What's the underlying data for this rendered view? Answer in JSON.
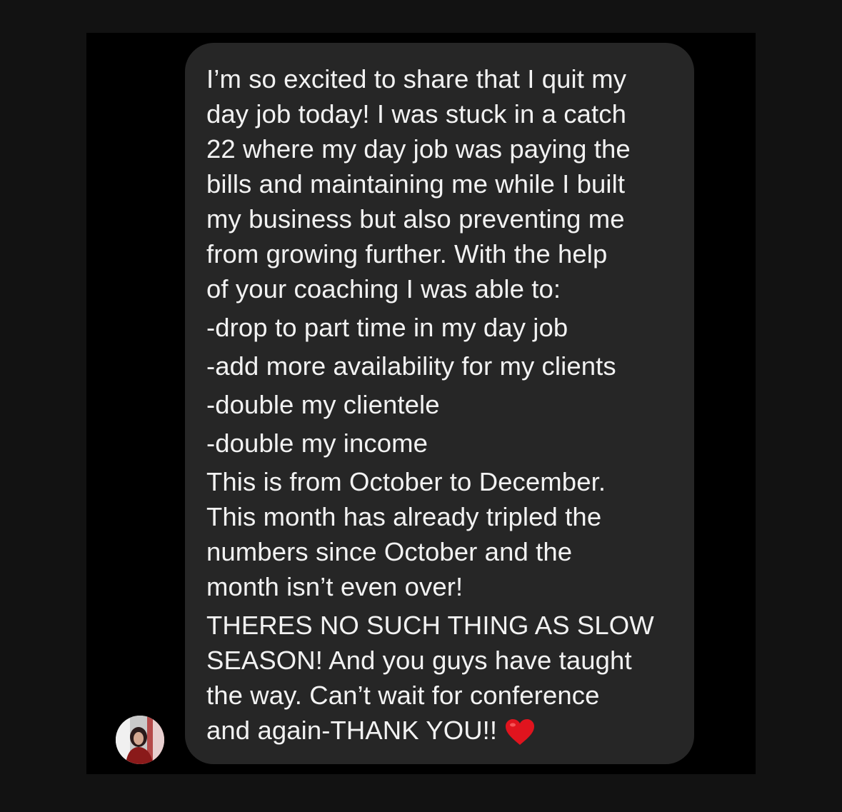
{
  "message": {
    "lines": [
      "I’m so excited to share that I quit my",
      "day job today! I was stuck in a catch",
      "22 where my day job was paying the",
      "bills and maintaining me while I built",
      "my business but also preventing me",
      "from growing further. With the help",
      "of your coaching I was able to:",
      "-drop to part time in my day job",
      "-add more availability for my clients",
      "-double my clientele",
      "-double my income",
      "This is from October to December.",
      "This month has already tripled the",
      "numbers since October and the",
      "month isn’t even over!",
      "THERES NO SUCH THING AS SLOW",
      "SEASON! And you guys have taught",
      "the way. Can’t wait for conference",
      "and again-THANK YOU!!"
    ],
    "emoji": "heart-emoji"
  },
  "sender": {
    "avatar": "sender-avatar"
  },
  "colors": {
    "page_background": "#121212",
    "chat_background": "#000000",
    "bubble_background": "#262626",
    "text": "#f2f2f2",
    "heart": "#e0141e"
  }
}
